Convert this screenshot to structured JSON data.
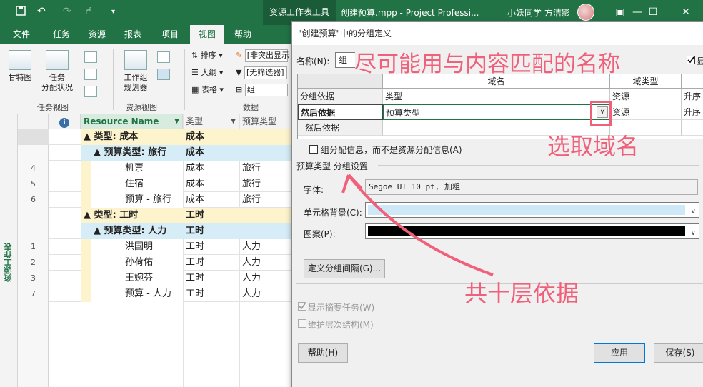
{
  "titlebar": {
    "context_tab": "资源工作表工具",
    "doc_title": "创建预算.mpp  -  Project Professi...",
    "user": "小妖同学 方洁影",
    "save_icon": "save-icon",
    "undo": "↶",
    "redo": "↷",
    "touch": "☝",
    "minimize": "—",
    "maximize": "☐",
    "close": "✕"
  },
  "ribbon_tabs": [
    "文件",
    "任务",
    "资源",
    "报表",
    "项目",
    "视图",
    "帮助"
  ],
  "ribbon": {
    "gantt": "甘特图",
    "task_usage_1": "任务",
    "task_usage_2": "分配状况",
    "team_planner_1": "工作组",
    "team_planner_2": "规划器",
    "sort": "排序",
    "outline": "大纲",
    "tables": "表格",
    "highlight": "[非突出显示",
    "filter": "[无筛选器]",
    "group": "组",
    "group_task_views": "任务视图",
    "group_resource_views": "资源视图",
    "group_data": "数据"
  },
  "sheet": {
    "sidebar_label": "资源工作表",
    "headers": [
      "Resource Name",
      "类型",
      "预算类型"
    ],
    "rows": [
      {
        "num": "",
        "name": "▲ 类型: 成本",
        "type": "成本",
        "budget": "",
        "level": 1
      },
      {
        "num": "",
        "name": "▲ 预算类型: 旅行",
        "type": "成本",
        "budget": "",
        "level": 2
      },
      {
        "num": "4",
        "name": "机票",
        "type": "成本",
        "budget": "旅行",
        "level": 3
      },
      {
        "num": "5",
        "name": "住宿",
        "type": "成本",
        "budget": "旅行",
        "level": 3
      },
      {
        "num": "6",
        "name": "预算 - 旅行",
        "type": "成本",
        "budget": "旅行",
        "level": 3
      },
      {
        "num": "",
        "name": "▲ 类型: 工时",
        "type": "工时",
        "budget": "",
        "level": 1
      },
      {
        "num": "",
        "name": "▲ 预算类型: 人力",
        "type": "工时",
        "budget": "",
        "level": 2
      },
      {
        "num": "1",
        "name": "洪国明",
        "type": "工时",
        "budget": "人力",
        "level": 3
      },
      {
        "num": "2",
        "name": "孙荷佑",
        "type": "工时",
        "budget": "人力",
        "level": 3
      },
      {
        "num": "3",
        "name": "王婉芬",
        "type": "工时",
        "budget": "人力",
        "level": 3
      },
      {
        "num": "7",
        "name": "预算 - 人力",
        "type": "工时",
        "budget": "人力",
        "level": 3
      }
    ]
  },
  "dialog": {
    "title": "\"创建预算\"中的分组定义",
    "name_label": "名称(N):",
    "name_value": "组",
    "grid_headers": [
      "域名",
      "域类型",
      ""
    ],
    "grid_rows": [
      {
        "label": "分组依据",
        "field": "类型",
        "type": "资源",
        "order": "升序"
      },
      {
        "label": "然后依据",
        "field": "预算类型",
        "type": "资源",
        "order": "升序"
      },
      {
        "label": "然后依据",
        "field": "",
        "type": "",
        "order": ""
      }
    ],
    "assignment_check": "组分配信息，而不是资源分配信息(A)",
    "settings_title": "预算类型 分组设置",
    "font_label": "字体:",
    "font_value": "Segoe UI 10 pt, 加粗",
    "cell_bg_label": "单元格背景(C):",
    "pattern_label": "图案(P):",
    "define_interval": "定义分组间隔(G)...",
    "show_summary": "显示摘要任务(W)",
    "maintain_hierarchy": "维护层次结构(M)",
    "help": "帮助(H)",
    "apply": "应用",
    "save": "保存(S)",
    "show_check_label": "显"
  },
  "annotations": {
    "name_tip": "尽可能用与内容匹配的名称",
    "field_tip": "选取域名",
    "levels_tip": "共十层依据",
    "color": "#f0607a"
  }
}
